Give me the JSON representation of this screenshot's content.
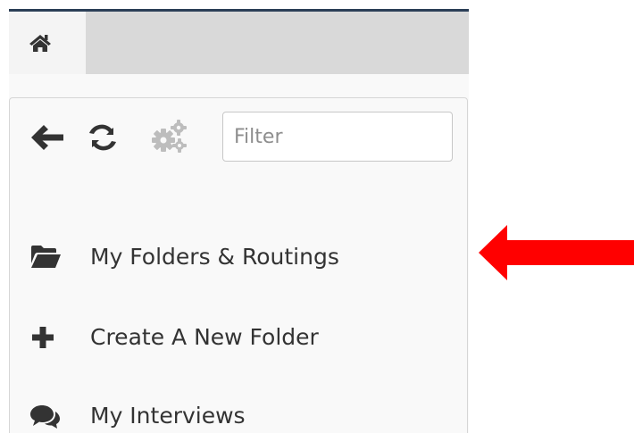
{
  "colors": {
    "accent_top": "#2b3f57",
    "tab_bar": "#d9d9d9",
    "icon_dark": "#333333",
    "icon_disabled": "#bdbdbd",
    "annotation_arrow": "#ff0000"
  },
  "tabs": [
    {
      "icon": "home-icon"
    }
  ],
  "toolbar": {
    "back_icon": "arrow-left-icon",
    "refresh_icon": "refresh-icon",
    "settings_icon": "gears-icon",
    "filter_placeholder": "Filter",
    "filter_value": ""
  },
  "menu": {
    "items": [
      {
        "icon": "folder-open-icon",
        "label": "My Folders & Routings"
      },
      {
        "icon": "plus-icon",
        "label": "Create A New Folder"
      },
      {
        "icon": "comments-icon",
        "label": "My Interviews"
      }
    ]
  },
  "annotation": {
    "icon": "red-arrow-left",
    "points_to": "My Folders & Routings"
  }
}
